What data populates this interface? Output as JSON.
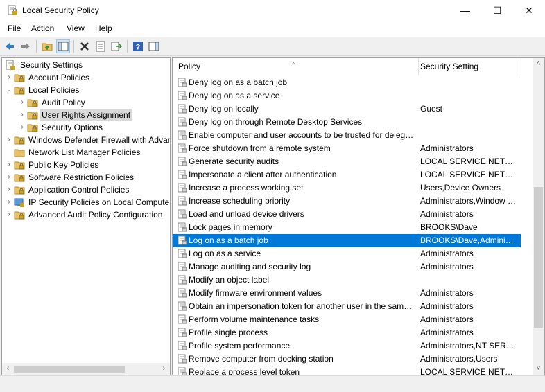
{
  "window": {
    "title": "Local Security Policy",
    "minimize_glyph": "—",
    "maximize_glyph": "☐",
    "close_glyph": "✕"
  },
  "menu": [
    "File",
    "Action",
    "View",
    "Help"
  ],
  "toolbar": [
    "back-arrow-icon",
    "forward-arrow-icon",
    "up-folder-icon",
    "show-hide-tree-icon",
    "delete-icon",
    "properties-icon",
    "export-list-icon",
    "help-icon",
    "show-pane-icon"
  ],
  "tree": {
    "root": "Security Settings",
    "items": [
      {
        "label": "Account Policies",
        "expander": "›"
      },
      {
        "label": "Local Policies",
        "expander": "⌄"
      },
      {
        "label": "Audit Policy",
        "expander": "›"
      },
      {
        "label": "User Rights Assignment",
        "expander": "›"
      },
      {
        "label": "Security Options",
        "expander": "›"
      },
      {
        "label": "Windows Defender Firewall with Advanced Security",
        "expander": "›"
      },
      {
        "label": "Network List Manager Policies",
        "expander": ""
      },
      {
        "label": "Public Key Policies",
        "expander": "›"
      },
      {
        "label": "Software Restriction Policies",
        "expander": "›"
      },
      {
        "label": "Application Control Policies",
        "expander": "›"
      },
      {
        "label": "IP Security Policies on Local Computer",
        "expander": "›"
      },
      {
        "label": "Advanced Audit Policy Configuration",
        "expander": "›"
      }
    ]
  },
  "list": {
    "columns": {
      "policy": "Policy",
      "setting": "Security Setting",
      "sort_caret": "^"
    },
    "rows": [
      {
        "policy": "Deny log on as a batch job",
        "setting": ""
      },
      {
        "policy": "Deny log on as a service",
        "setting": ""
      },
      {
        "policy": "Deny log on locally",
        "setting": "Guest"
      },
      {
        "policy": "Deny log on through Remote Desktop Services",
        "setting": ""
      },
      {
        "policy": "Enable computer and user accounts to be trusted for delegation",
        "setting": ""
      },
      {
        "policy": "Force shutdown from a remote system",
        "setting": "Administrators"
      },
      {
        "policy": "Generate security audits",
        "setting": "LOCAL SERVICE,NETWORK SERVICE"
      },
      {
        "policy": "Impersonate a client after authentication",
        "setting": "LOCAL SERVICE,NETWORK SERVICE"
      },
      {
        "policy": "Increase a process working set",
        "setting": "Users,Device Owners"
      },
      {
        "policy": "Increase scheduling priority",
        "setting": "Administrators,Window Manager"
      },
      {
        "policy": "Load and unload device drivers",
        "setting": "Administrators"
      },
      {
        "policy": "Lock pages in memory",
        "setting": "BROOKS\\Dave"
      },
      {
        "policy": "Log on as a batch job",
        "setting": "BROOKS\\Dave,Administrators"
      },
      {
        "policy": "Log on as a service",
        "setting": "Administrators"
      },
      {
        "policy": "Manage auditing and security log",
        "setting": "Administrators"
      },
      {
        "policy": "Modify an object label",
        "setting": ""
      },
      {
        "policy": "Modify firmware environment values",
        "setting": "Administrators"
      },
      {
        "policy": "Obtain an impersonation token for another user in the same session",
        "setting": "Administrators"
      },
      {
        "policy": "Perform volume maintenance tasks",
        "setting": "Administrators"
      },
      {
        "policy": "Profile single process",
        "setting": "Administrators"
      },
      {
        "policy": "Profile system performance",
        "setting": "Administrators,NT SERVICE"
      },
      {
        "policy": "Remove computer from docking station",
        "setting": "Administrators,Users"
      },
      {
        "policy": "Replace a process level token",
        "setting": "LOCAL SERVICE,NETWORK SERVICE"
      }
    ]
  },
  "colors": {
    "selection": "#0078d7",
    "folder": "#e8c26a",
    "lock": "#c9a227"
  }
}
